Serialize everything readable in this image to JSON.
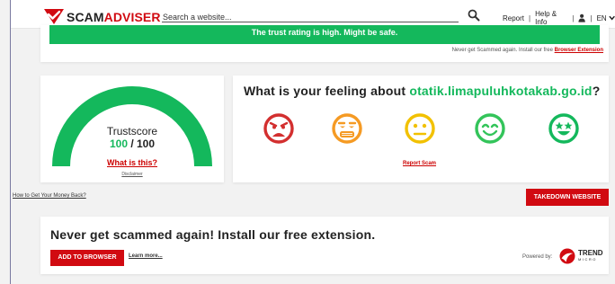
{
  "header": {
    "logo_part1": "SCAM",
    "logo_part2": "ADVISER",
    "search_placeholder": "Search a website...",
    "nav": {
      "report": "Report",
      "help": "Help & Info",
      "lang": "EN"
    }
  },
  "banner": {
    "message": "The trust rating is high. Might be safe.",
    "note": "Never get Scammed again. Install our free",
    "note_link": "Browser Extension"
  },
  "trustscore": {
    "label": "Trustscore",
    "score": "100",
    "out_of": " / 100",
    "level": 1.0,
    "what_link": "What is this?",
    "disclaimer": "Disclaimer"
  },
  "feeling": {
    "question": "What is your feeling about",
    "domain": "otatik.limapuluhkotakab.go.id",
    "qmark": "?",
    "faces": [
      "angry-face",
      "annoyed-face",
      "neutral-face",
      "happy-face",
      "star-eyes-face"
    ],
    "report_link": "Report Scam"
  },
  "money_link": "How to Get Your Money Back?",
  "takedown_button": "TAKEDOWN WEBSITE",
  "extension": {
    "title": "Never get scammed again! Install our free extension.",
    "add_button": "ADD TO BROWSER",
    "learn_more": "Learn more...",
    "powered_by": "Powered by:",
    "trend": "TREND",
    "micro": "MICRO"
  },
  "colors": {
    "brand_red": "#d10a11",
    "trust_green": "#14b85c",
    "face_red": "#d32f2f",
    "face_orange": "#f59a23",
    "face_yellow": "#f2c100",
    "face_lightgreen": "#33c45a",
    "face_green": "#14b85c"
  }
}
